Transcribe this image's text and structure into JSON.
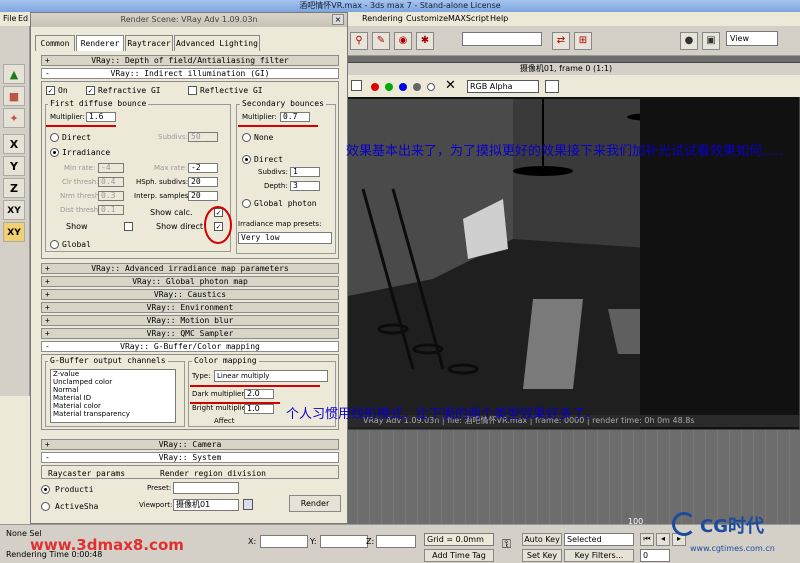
{
  "app": {
    "title": "酒吧情怀VR.max - 3ds max 7 - Stand-alone License"
  },
  "menu": {
    "file": "File",
    "edit": "Ed",
    "rendering": "Rendering",
    "customize": "Customize",
    "maxscript": "MAXScript",
    "help": "Help"
  },
  "toolbar": {
    "view_label": "View"
  },
  "left_tools": [
    "X",
    "Y",
    "Z",
    "XY",
    "XY"
  ],
  "render_scene": {
    "title": "Render Scene: VRay Adv 1.09.03n",
    "close": "×",
    "tabs": [
      "Common",
      "Renderer",
      "Raytracer",
      "Advanced Lighting"
    ],
    "rollouts_top": [
      "VRay:: Depth of field/Antialiasing filter",
      "VRay:: Indirect illumination (GI)"
    ],
    "gi": {
      "on": "On",
      "refractive": "Refractive GI",
      "reflective": "Reflective GI",
      "first_title": "First diffuse bounce",
      "first_mult_label": "Multiplier:",
      "first_mult": "1.6",
      "second_title": "Secondary bounces",
      "second_mult_label": "Multiplier:",
      "second_mult": "0.7",
      "direct": "Direct",
      "subdivs_label": "Subdivs:",
      "subdivs_val": "50",
      "irradiance": "Irradiance",
      "min_rate_label": "Min rate:",
      "min_rate": "-4",
      "max_rate_label": "Max rate:",
      "max_rate": "-2",
      "clr_label": "Clr thresh:",
      "clr": "0.4",
      "hsph_label": "HSph. subdivs:",
      "hsph": "20",
      "nrm_label": "Nrm thresh:",
      "nrm": "0.3",
      "interp_label": "Interp. samples:",
      "interp": "20",
      "dist_label": "Dist thresh:",
      "dist": "0.1",
      "show_calc": "Show calc.",
      "show": "Show",
      "show_direct": "Show direct",
      "global": "Global",
      "none": "None",
      "direct2": "Direct",
      "subdivs2_label": "Subdivs:",
      "subdivs2": "1",
      "depth_label": "Depth:",
      "depth": "3",
      "global_photon": "Global photon",
      "presets_label": "Irradiance map presets:",
      "presets": "Very low"
    },
    "rollouts_mid": [
      "VRay:: Advanced irradiance map parameters",
      "VRay:: Global photon map",
      "VRay:: Caustics",
      "VRay:: Environment",
      "VRay:: Motion blur",
      "VRay:: QMC Sampler",
      "VRay:: G-Buffer/Color mapping"
    ],
    "gbuffer": {
      "channels_title": "G-Buffer output channels",
      "channels": [
        "Z-value",
        "Unclamped color",
        "Normal",
        "Material ID",
        "Material color",
        "Material transparency"
      ],
      "color_title": "Color mapping",
      "type_label": "Type:",
      "type_val": "Linear multiply",
      "dark_label": "Dark multiplier:",
      "dark_val": "2.0",
      "bright_label": "Bright multiplier:",
      "bright_val": "1.0",
      "affect": "Affect"
    },
    "rollouts_bottom": [
      "VRay:: Camera",
      "VRay:: System"
    ],
    "system": {
      "raycaster": "Raycaster params",
      "region": "Render region division"
    },
    "production": "Producti",
    "activeshade": "ActiveSha",
    "preset_label": "Preset:",
    "preset_val": "",
    "viewport_label": "Viewport:",
    "viewport_val": "摄像机01",
    "render_button": "Render"
  },
  "frame_buffer": {
    "title": "摄像机01, frame 0 (1:1)",
    "channel": "RGB Alpha",
    "status": "VRay Adv 1.09.03n | file: 酒吧情怀VR.max | frame: 0000 | render time: 0h 0m 48.8s"
  },
  "annotations": {
    "top": "效果基本出来了，为了摸拟更好的效果接下来我们加补光试试看效果如何.....",
    "bottom": "个人习惯用线形模式，比下面的两个类型效果好多了。"
  },
  "bottom_bar": {
    "none_sel": "None Sel",
    "rendering_time": "Rendering Time  0:00:48",
    "x": "X:",
    "y": "Y:",
    "z": "Z:",
    "grid": "Grid = 0.0mm",
    "add_time_tag": "Add Time Tag",
    "auto_key": "Auto Key",
    "set_key": "Set Key",
    "selected": "Selected",
    "key_filters": "Key Filters...",
    "frame": "0",
    "ruler_100": "100"
  },
  "watermarks": {
    "left": "www.3dmax8.com",
    "right": "CG时代",
    "right_small": "www.cgtimes.com.cn"
  },
  "colors": {
    "annotation": "#0a00c8",
    "red_mark": "#d20000"
  }
}
